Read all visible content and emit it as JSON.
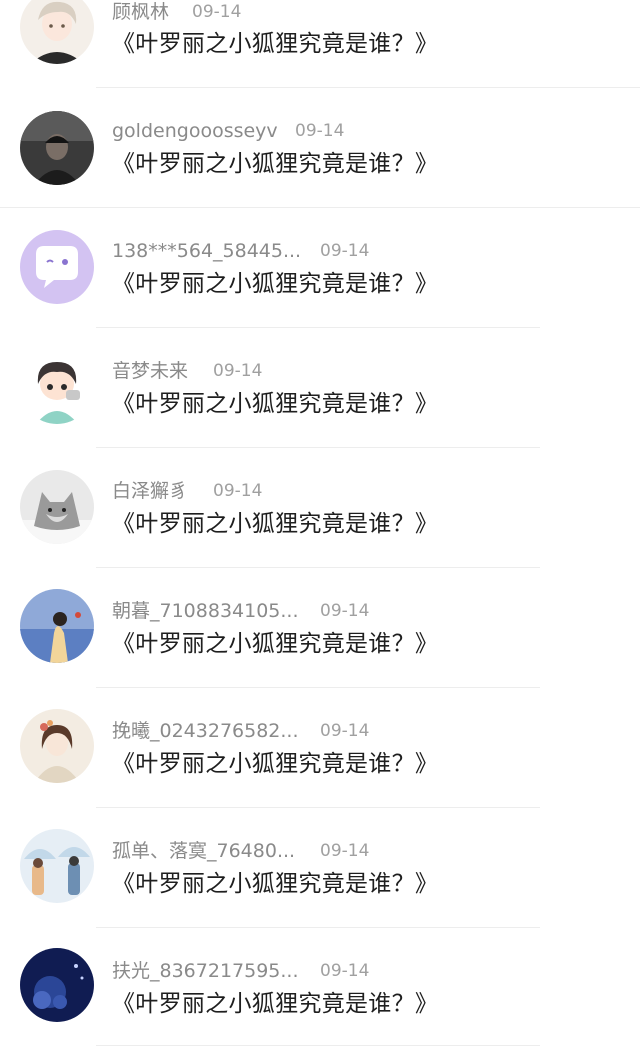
{
  "comments": [
    {
      "username": "顾枫林",
      "date": "09-14",
      "text": "《叶罗丽之小狐狸究竟是谁？》",
      "avatar": "boy-silver-hair-avatar"
    },
    {
      "username": "goldengooosseyv",
      "date": "09-14",
      "text": "《叶罗丽之小狐狸究竟是谁？》",
      "avatar": "dark-photo-man-avatar"
    },
    {
      "username": "138***564_58445...",
      "date": "09-14",
      "text": "《叶罗丽之小狐狸究竟是谁？》",
      "avatar": "purple-chat-bubble-avatar"
    },
    {
      "username": "音梦未来",
      "date": "09-14",
      "text": "《叶罗丽之小狐狸究竟是谁？》",
      "avatar": "chibi-boy-avatar"
    },
    {
      "username": "白泽獬豸",
      "date": "09-14",
      "text": "《叶罗丽之小狐狸究竟是谁？》",
      "avatar": "wolf-avatar"
    },
    {
      "username": "朝暮_7108834105...",
      "date": "09-14",
      "text": "《叶罗丽之小狐狸究竟是谁？》",
      "avatar": "girl-seaside-avatar"
    },
    {
      "username": "挽曦_0243276582...",
      "date": "09-14",
      "text": "《叶罗丽之小狐狸究竟是谁？》",
      "avatar": "ancient-style-girl-avatar"
    },
    {
      "username": "孤单、落寞_76480...",
      "date": "09-14",
      "text": "《叶罗丽之小狐狸究竟是谁？》",
      "avatar": "couple-umbrella-avatar"
    },
    {
      "username": "扶光_8367217595...",
      "date": "09-14",
      "text": "《叶罗丽之小狐狸究竟是谁？》",
      "avatar": "blue-night-avatar"
    }
  ]
}
